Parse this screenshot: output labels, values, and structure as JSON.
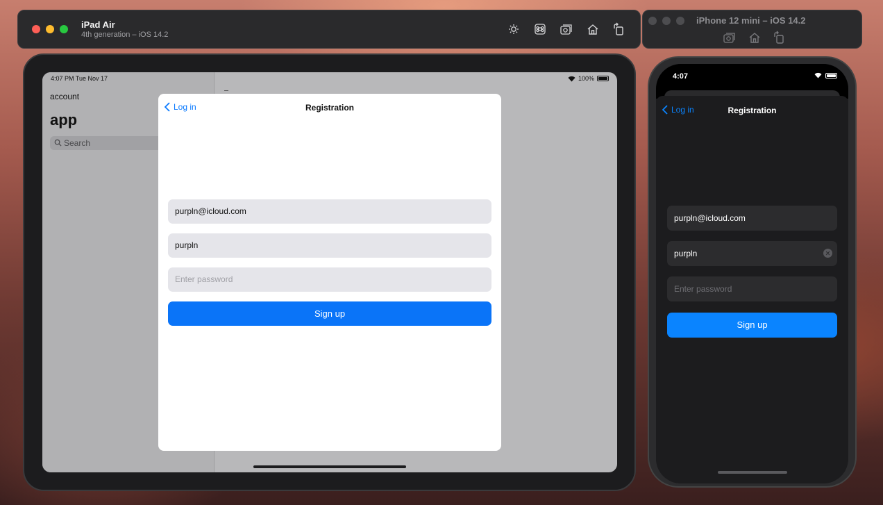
{
  "ipad_window": {
    "title": "iPad Air",
    "subtitle": "4th generation – iOS 14.2",
    "tools": [
      "brightness-icon",
      "command-icon",
      "screenshot-icon",
      "home-icon",
      "rotate-icon"
    ]
  },
  "iphone_window": {
    "title": "iPhone 12 mini – iOS 14.2",
    "tools": [
      "screenshot-icon",
      "home-icon",
      "rotate-icon"
    ]
  },
  "ipad": {
    "status": {
      "time": "4:07 PM  Tue Nov 17",
      "battery": "100%"
    },
    "sidebar": {
      "account": "account",
      "title": "app",
      "search_placeholder": "Search"
    },
    "modal": {
      "back_label": "Log in",
      "title": "Registration",
      "email_value": "purpln@icloud.com",
      "username_value": "purpln",
      "password_placeholder": "Enter password",
      "signup_label": "Sign up"
    }
  },
  "iphone": {
    "status": {
      "time": "4:07"
    },
    "nav": {
      "back_label": "Log in",
      "title": "Registration"
    },
    "email_value": "purpln@icloud.com",
    "username_value": "purpln",
    "password_placeholder": "Enter password",
    "signup_label": "Sign up"
  },
  "colors": {
    "accent": "#0a74f8",
    "accent_dark": "#0a84ff"
  }
}
